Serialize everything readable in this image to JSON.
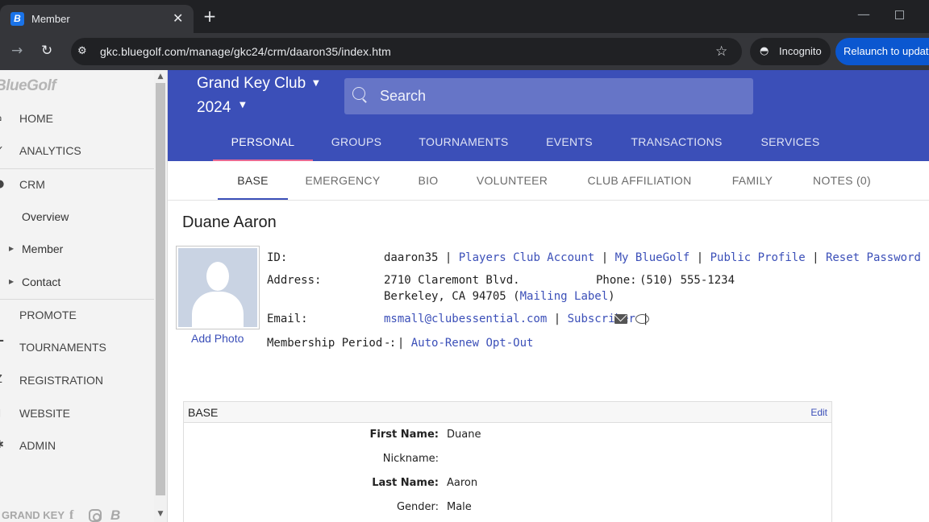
{
  "browser": {
    "tab_title": "Member",
    "tab_favicon": "B",
    "url": "gkc.bluegolf.com/manage/gkc24/crm/daaron35/index.htm",
    "incognito_label": "Incognito",
    "relaunch_label": "Relaunch to update"
  },
  "sidebar": {
    "logo": "BlueGolf",
    "items": [
      {
        "label": "HOME",
        "icon": "home-icon"
      },
      {
        "label": "ANALYTICS",
        "icon": "analytics-icon"
      },
      {
        "label": "CRM",
        "icon": "crm-icon"
      },
      {
        "label": "PROMOTE",
        "icon": "promote-icon"
      },
      {
        "label": "TOURNAMENTS",
        "icon": "tournaments-icon"
      },
      {
        "label": "REGISTRATION",
        "icon": "registration-icon"
      },
      {
        "label": "WEBSITE",
        "icon": "website-icon"
      },
      {
        "label": "ADMIN",
        "icon": "admin-icon"
      }
    ],
    "crm_sub": [
      {
        "label": "Overview"
      },
      {
        "label": "Member"
      },
      {
        "label": "Contact"
      }
    ],
    "footer_club": "GRAND KEY"
  },
  "header": {
    "club_name": "Grand Key Club",
    "season": "2024",
    "search_placeholder": "Search",
    "tabs": [
      "PERSONAL",
      "GROUPS",
      "TOURNAMENTS",
      "EVENTS",
      "TRANSACTIONS",
      "SERVICES"
    ],
    "active_tab": "PERSONAL"
  },
  "subtabs": {
    "items": [
      "BASE",
      "EMERGENCY",
      "BIO",
      "VOLUNTEER",
      "CLUB AFFILIATION",
      "FAMILY",
      "NOTES (0)"
    ],
    "active": "BASE"
  },
  "member": {
    "name": "Duane Aaron",
    "add_photo": "Add Photo",
    "id_label": "ID:",
    "id_value": "daaron35",
    "id_links": [
      "Players Club Account",
      "My BlueGolf",
      "Public Profile",
      "Reset Password"
    ],
    "address_label": "Address:",
    "address_line1": "2710 Claremont Blvd.",
    "address_line2": "Berkeley, CA 94705",
    "mailing_label": "Mailing Label",
    "phone_label": "Phone:",
    "phone_value": "(510) 555-1234",
    "email_label": "Email:",
    "email_value": "msmall@clubessential.com",
    "subscriber": "Subscriber",
    "membership_label": "Membership Period :",
    "membership_value": "-",
    "auto_renew": "Auto-Renew Opt-Out"
  },
  "base_panel": {
    "title": "BASE",
    "edit": "Edit",
    "fields": [
      {
        "label": "First Name:",
        "value": "Duane"
      },
      {
        "label": "Nickname:",
        "value": ""
      },
      {
        "label": "Last Name:",
        "value": "Aaron"
      },
      {
        "label": "Gender:",
        "value": "Male"
      }
    ]
  },
  "colors": {
    "brand_blue": "#3b4fb8",
    "active_tab_accent": "#e86a93",
    "link": "#3b4fb8"
  }
}
